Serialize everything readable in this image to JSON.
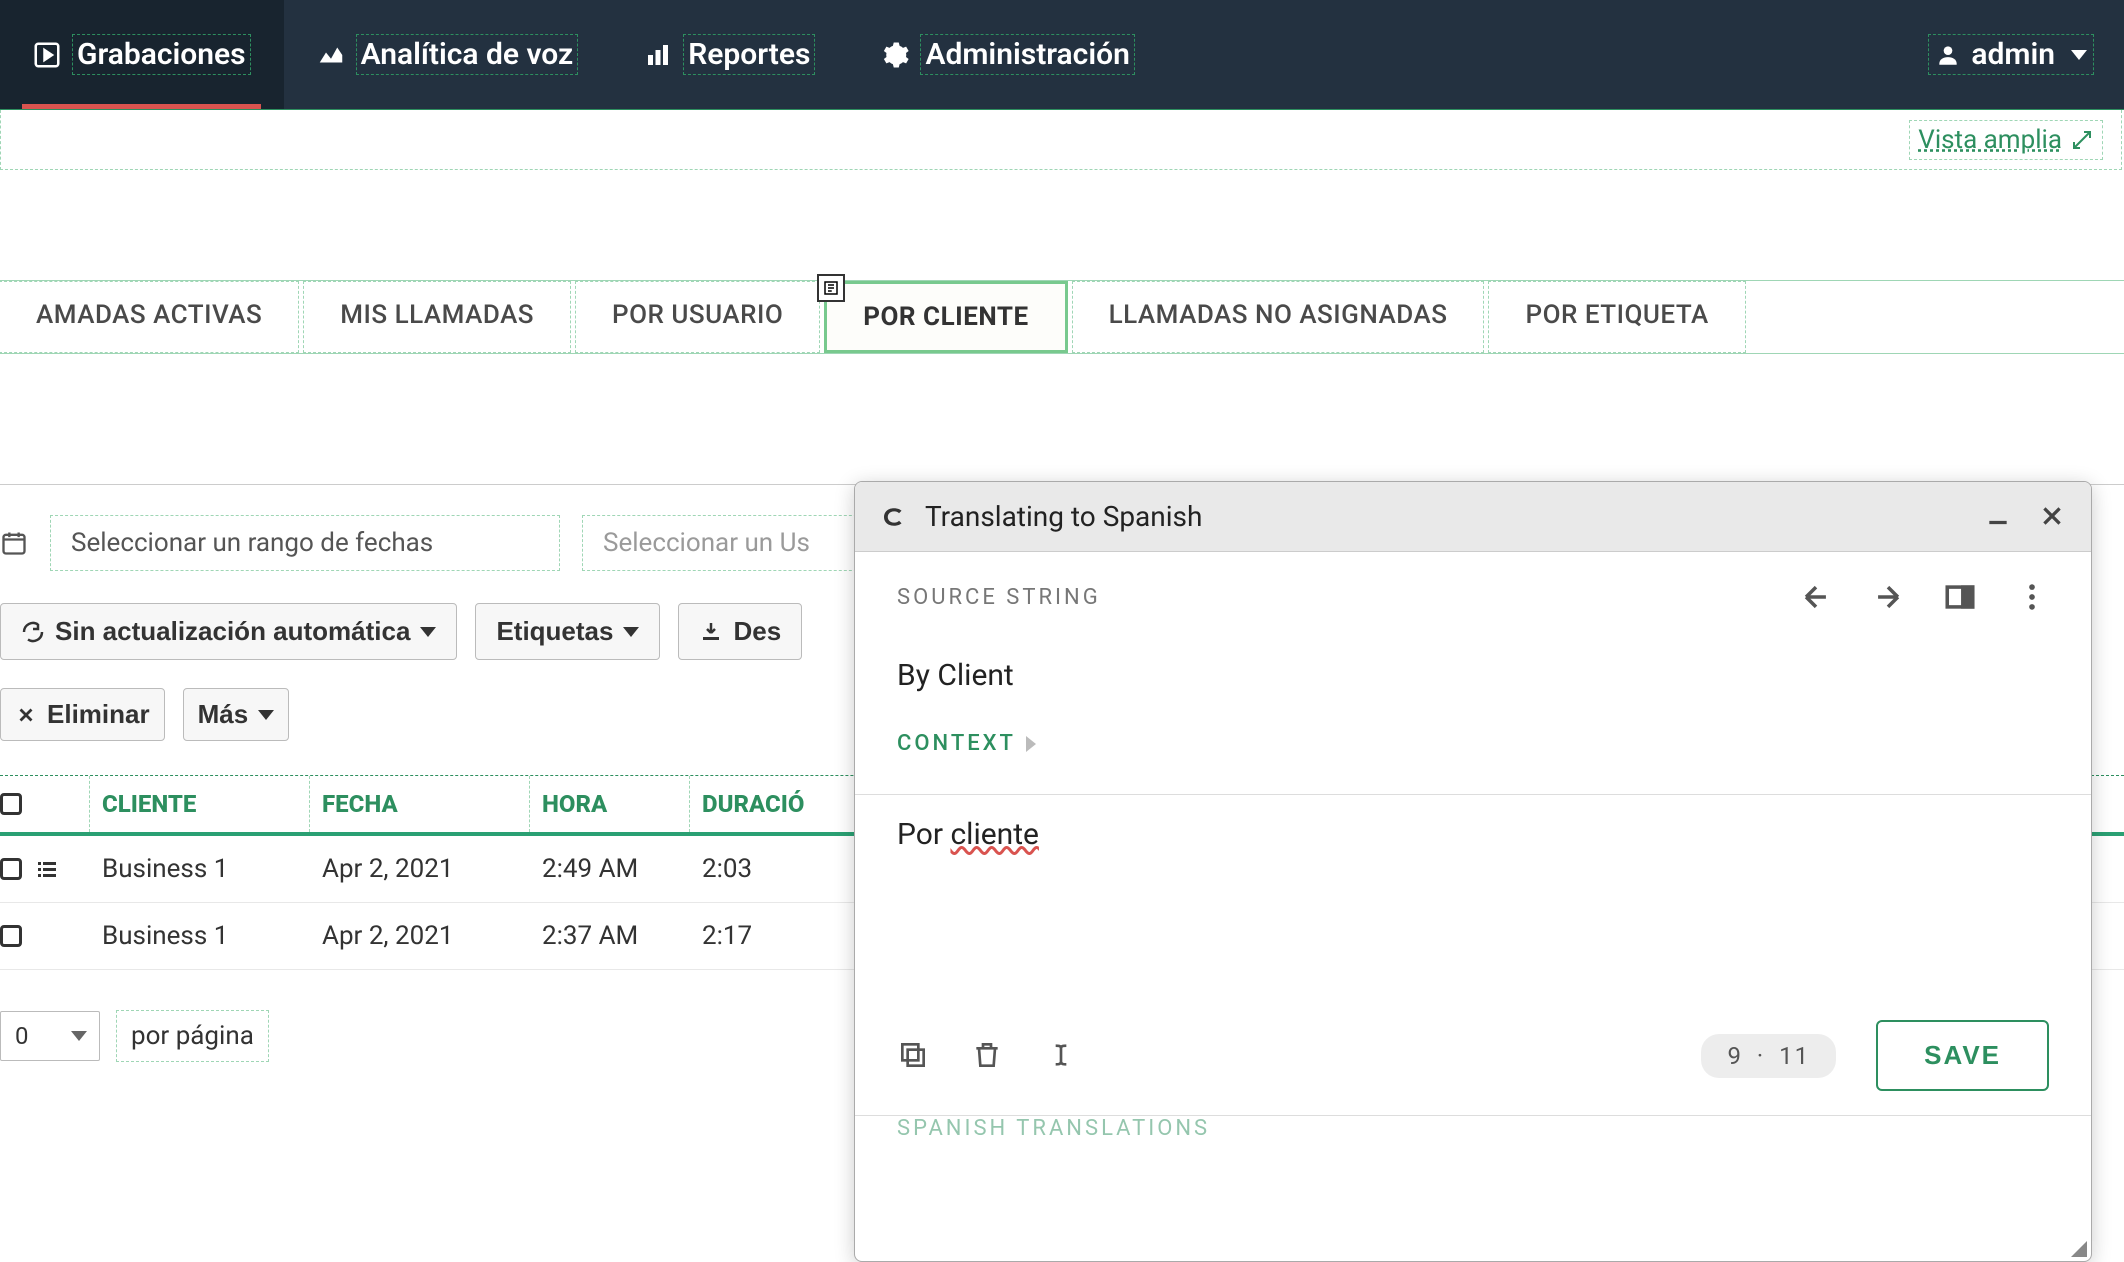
{
  "topnav": {
    "items": [
      {
        "label": "Grabaciones"
      },
      {
        "label": "Analítica de voz"
      },
      {
        "label": "Reportes"
      },
      {
        "label": "Administración"
      }
    ],
    "user": "admin"
  },
  "wideview_label": "Vista amplia",
  "tabs": {
    "items": [
      {
        "label": "AMADAS ACTIVAS"
      },
      {
        "label": "MIS LLAMADAS"
      },
      {
        "label": "POR USUARIO"
      },
      {
        "label": "POR CLIENTE"
      },
      {
        "label": "LLAMADAS NO ASIGNADAS"
      },
      {
        "label": "POR ETIQUETA"
      }
    ]
  },
  "filters": {
    "date_placeholder": "Seleccionar un rango de fechas",
    "user_placeholder": "Seleccionar un Us",
    "auto_refresh_label": "Sin actualización automática",
    "tags_label": "Etiquetas",
    "download_label": "Des",
    "delete_label": "Eliminar",
    "more_label": "Más"
  },
  "table": {
    "headers": {
      "cliente": "CLIENTE",
      "fecha": "FECHA",
      "hora": "HORA",
      "duracion": "DURACIÓ"
    },
    "rows": [
      {
        "cliente": "Business 1",
        "fecha": "Apr 2, 2021",
        "hora": "2:49 AM",
        "dur": "2:03"
      },
      {
        "cliente": "Business 1",
        "fecha": "Apr 2, 2021",
        "hora": "2:37 AM",
        "dur": "2:17"
      }
    ]
  },
  "paging": {
    "page_size": "0",
    "per_page_label": "por página"
  },
  "trans_panel": {
    "title": "Translating to Spanish",
    "source_label": "SOURCE STRING",
    "source_value": "By Client",
    "context_label": "CONTEXT",
    "translated_prefix": "Por ",
    "translated_word": "cliente",
    "count_current": "9",
    "count_sep": "·",
    "count_total": "11",
    "save_label": "SAVE",
    "footnote": "SPANISH TRANSLATIONS"
  }
}
